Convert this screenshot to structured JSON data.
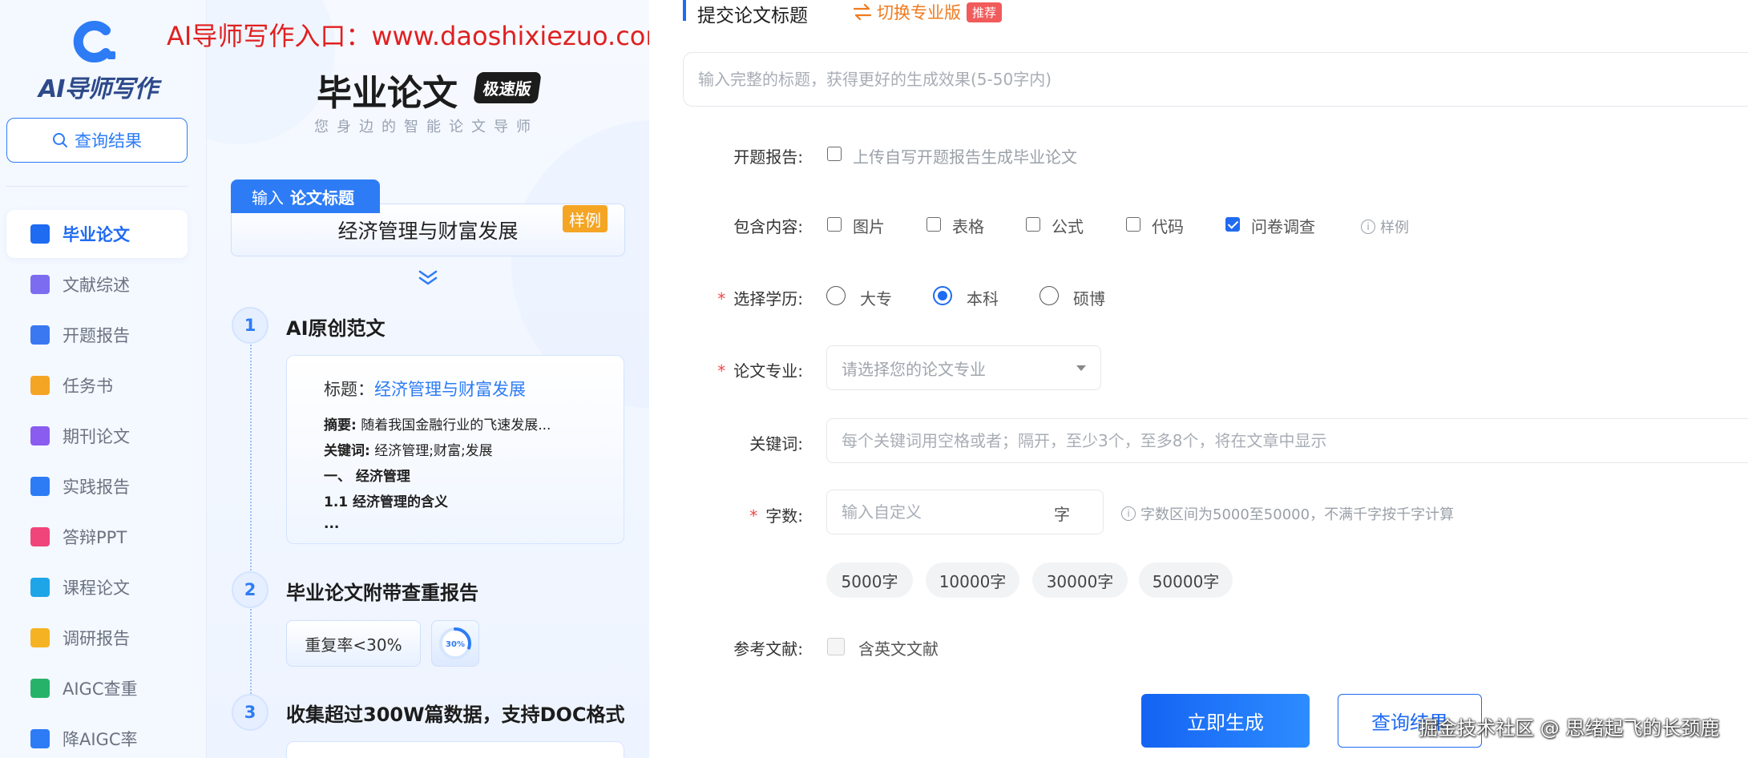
{
  "sidebar": {
    "logo_text": "AI导师写作",
    "query_button": "查询结果",
    "items": [
      {
        "label": "毕业论文",
        "icon": "graduation-cap-icon",
        "color": "#1f6bf2",
        "active": true
      },
      {
        "label": "文献综述",
        "icon": "document-list-icon",
        "color": "#7c6cf0",
        "active": false
      },
      {
        "label": "开题报告",
        "icon": "printer-report-icon",
        "color": "#3a78f2",
        "active": false
      },
      {
        "label": "任务书",
        "icon": "task-edit-icon",
        "color": "#f5a524",
        "active": false
      },
      {
        "label": "期刊论文",
        "icon": "journal-book-icon",
        "color": "#8a5cf0",
        "active": false
      },
      {
        "label": "实践报告",
        "icon": "practice-edit-icon",
        "color": "#2d7cf6",
        "active": false
      },
      {
        "label": "答辩PPT",
        "icon": "ppt-icon",
        "color": "#f0457a",
        "active": false
      },
      {
        "label": "课程论文",
        "icon": "course-book-icon",
        "color": "#1ea5e8",
        "active": false
      },
      {
        "label": "调研报告",
        "icon": "clipboard-icon",
        "color": "#f5b324",
        "active": false
      },
      {
        "label": "AIGC查重",
        "icon": "aigc-check-icon",
        "color": "#27b26a",
        "active": false
      },
      {
        "label": "降AIGC率",
        "icon": "trend-down-icon",
        "color": "#2d7cf6",
        "active": false
      }
    ]
  },
  "promo": {
    "banner": "AI导师写作入口：www.daoshixiezuo.com",
    "title": "毕业论文",
    "speed_badge": "极速版",
    "subtitle": "您身边的智能论文导师",
    "input_tag_prefix": "输入",
    "input_tag_bold": "论文标题",
    "example_topic": "经济管理与财富发展",
    "sample_tag": "样例",
    "steps": [
      {
        "num": "1",
        "title": "AI原创范文"
      },
      {
        "num": "2",
        "title": "毕业论文附带查重报告"
      },
      {
        "num": "3",
        "title": "收集超过300W篇数据，支持DOC格式"
      }
    ],
    "essay": {
      "title_label": "标题：",
      "title_value": "经济管理与财富发展",
      "abstract_label": "摘要:",
      "abstract_value": " 随着我国金融行业的飞速发展...",
      "keywords_label": "关键词:",
      "keywords_value": " 经济管理;财富;发展",
      "heading1": "一、 经济管理",
      "heading2": "1.1 经济管理的含义",
      "ellipsis": "..."
    },
    "dup_rate": "重复率<30%",
    "gauge_label": "30%",
    "gauge_value": 0.3
  },
  "form": {
    "header": "提交论文标题",
    "switch_link": "切换专业版",
    "recommend_badge": "推荐",
    "title_placeholder": "输入完整的标题，获得更好的生成效果(5-50字内)",
    "proposal_label": "开题报告:",
    "proposal_option": "上传自写开题报告生成毕业论文",
    "contents_label": "包含内容:",
    "contents": [
      {
        "label": "图片",
        "checked": false
      },
      {
        "label": "表格",
        "checked": false
      },
      {
        "label": "公式",
        "checked": false
      },
      {
        "label": "代码",
        "checked": false
      },
      {
        "label": "问卷调查",
        "checked": true
      }
    ],
    "contents_hint": "样例",
    "degree_label": "选择学历:",
    "degrees": [
      {
        "label": "大专",
        "checked": false
      },
      {
        "label": "本科",
        "checked": true
      },
      {
        "label": "硕博",
        "checked": false
      }
    ],
    "major_label": "论文专业:",
    "major_placeholder": "请选择您的论文专业",
    "keywords_label": "关键词:",
    "keywords_placeholder": "每个关键词用空格或者；隔开，至少3个，至多8个，将在文章中显示",
    "wordcount_label": "字数:",
    "wordcount_placeholder": "输入自定义",
    "wordcount_unit": "字",
    "wordcount_hint": "字数区间为5000至50000，不满千字按千字计算",
    "wordcount_chips": [
      "5000字",
      "10000字",
      "30000字",
      "50000字"
    ],
    "refs_label": "参考文献:",
    "refs_option": "含英文文献",
    "generate_button": "立即生成",
    "query_button": "查询结果"
  },
  "watermark": "掘金技术社区 @ 思绪起飞的长颈鹿"
}
